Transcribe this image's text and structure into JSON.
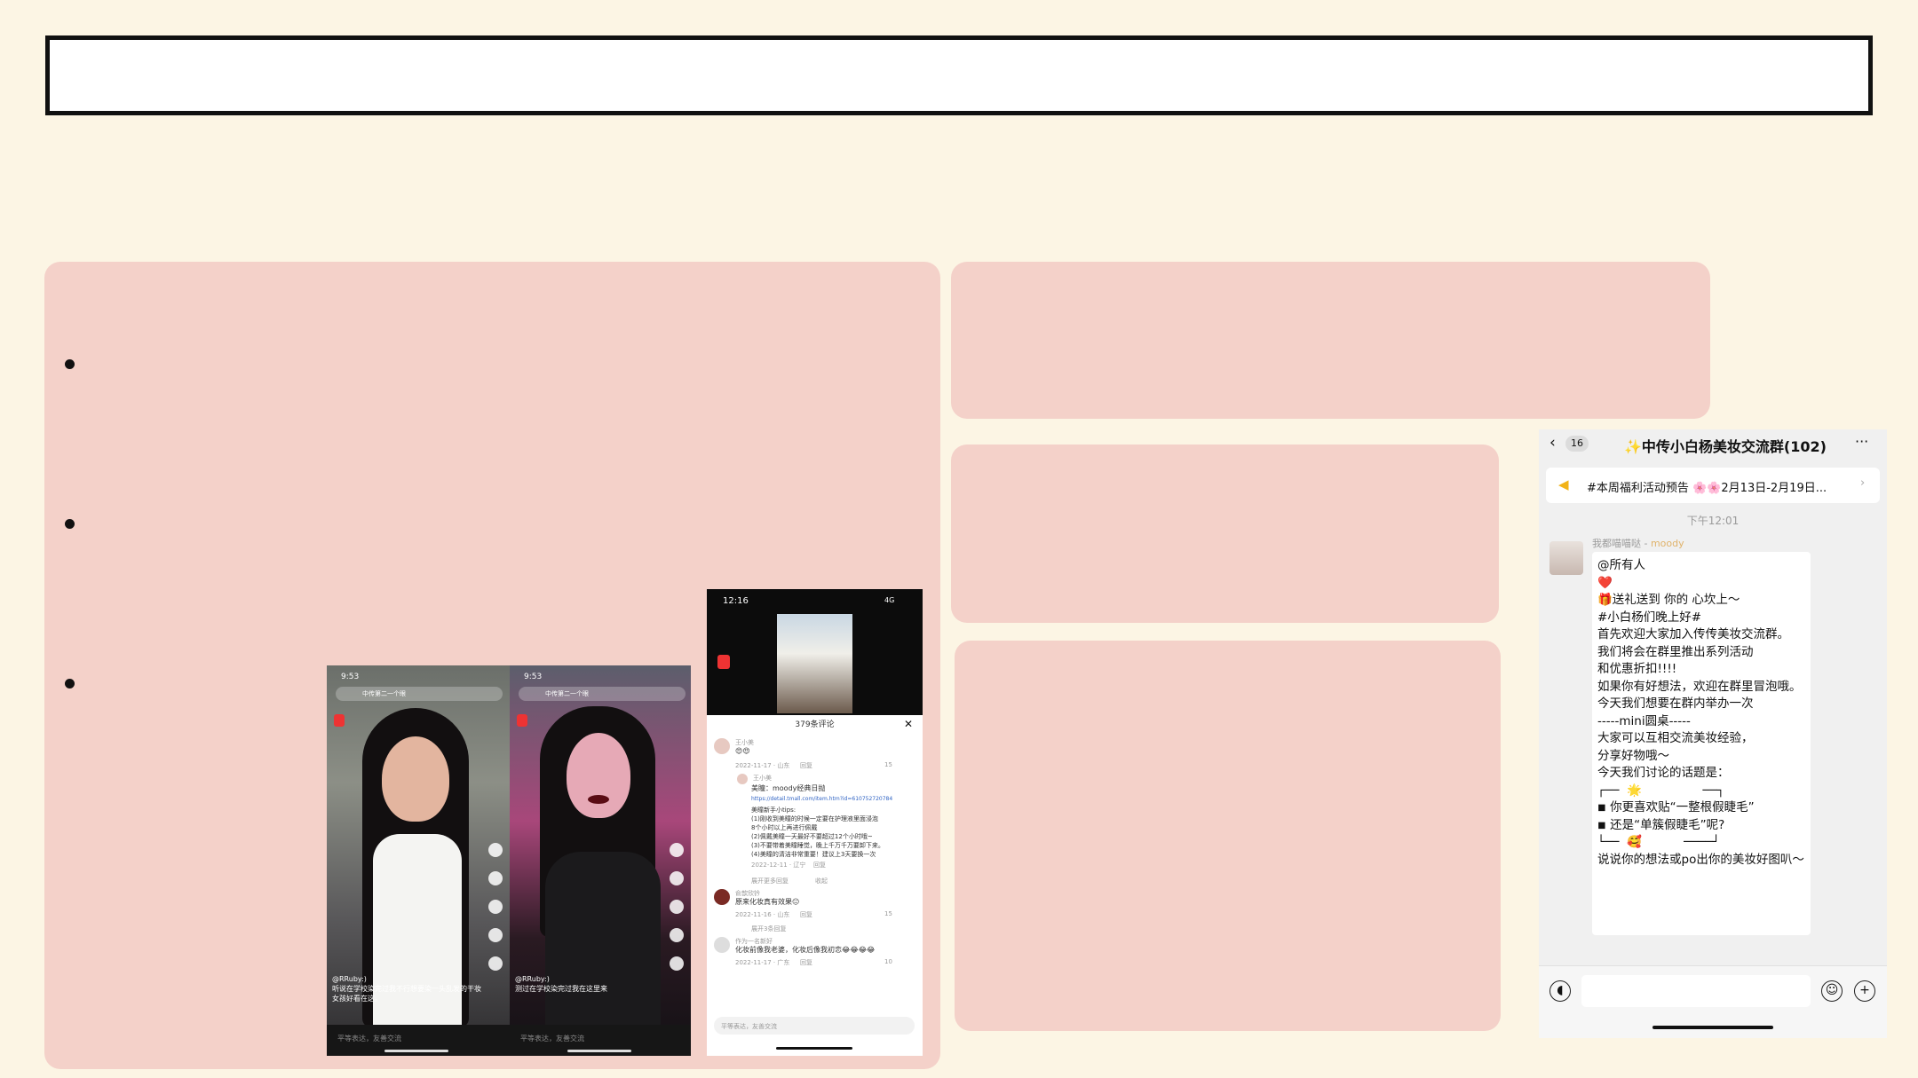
{
  "slide": {
    "title": ""
  },
  "screenshot_tt1": {
    "status_time": "9:53",
    "search_placeholder": "中传第二一个眼",
    "user": "@RRuby:)",
    "caption": "听说在学校染完过我不行想要染一头乱发的干妆女孩好看在这。",
    "input_placeholder": "平等表达，友善交流"
  },
  "screenshot_tt2": {
    "status_time": "9:53",
    "search_placeholder": "中传第二一个眼",
    "user": "@RRuby:)",
    "caption": "测过在学校染完过我在这里来",
    "input_placeholder": "平等表达，友善交流"
  },
  "screenshot_comments": {
    "status_time": "12:16",
    "status_right": "4G",
    "comment_count_title": "379条评论",
    "comments": [
      {
        "user": "王小美",
        "text": "😍😍",
        "meta": "2022-11-17 · 山东",
        "reply": "回复",
        "likes": "15"
      },
      {
        "user": "王小美",
        "text": "美瞳：moody经典日抛",
        "link": "https://detail.tmall.com/item.htm?id=610752720784",
        "tips_title": "美瞳新手小tips:",
        "tips": [
          "(1)刚收到美瞳的时候一定要在护理液里面浸泡",
          "8个小时以上再进行佩戴",
          "(2)佩戴美瞳一天最好不要超过12个小时哦~",
          "(3)不要带着美瞳睡觉，晚上千万千万要卸下来。",
          "(4)美瞳的清洁非常重要！建议上3天要换一次"
        ],
        "meta": "2022-12-11 · 辽宁",
        "reply": "回复"
      },
      {
        "user": "俞歆欣钤",
        "text": "原来化妆真有效果😐",
        "meta": "2022-11-16 · 山东",
        "reply": "回复",
        "likes": "15"
      },
      {
        "user": "作为一名新好",
        "text": "化妆前像我老婆，化妆后像我初恋😂😂😂😂",
        "meta": "2022-11-17 · 广东",
        "reply": "回复",
        "likes": "10"
      }
    ],
    "expand_more": "展开更多回复",
    "collapse": "收起",
    "expand_3": "展开3条回复",
    "input_placeholder": "平等表达，友善交流"
  },
  "chat": {
    "back_count": "16",
    "group_name": "✨中传小白杨美妆交流群(102)",
    "notice": "#本周福利活动预告 🌸🌸2月13日-2月19日...",
    "time": "下午12:01",
    "sender": "我都喵喵哒 - ",
    "sender_tag": "moody",
    "message_lines": [
      "@所有人",
      "❤️",
      "🎁送礼送到 你的 心坎上～",
      "#小白杨们晚上好#",
      "首先欢迎大家加入传传美妆交流群。",
      "我们将会在群里推出系列活动",
      "和优惠折扣!!!!",
      "如果你有好想法，欢迎在群里冒泡哦。",
      "",
      "今天我们想要在群内举办一次",
      "-----mini圆桌-----",
      "",
      "大家可以互相交流美妆经验，",
      "分享好物哦～",
      "今天我们讨论的话题是：",
      "┌──  🌟                ──┐",
      "◾ 你更喜欢贴“一整根假睫毛”",
      "◾ 还是“单簇假睫毛”呢?",
      "└──  🥰           ────┘",
      "",
      "说说你的想法或po出你的美妆好图叭～"
    ]
  }
}
